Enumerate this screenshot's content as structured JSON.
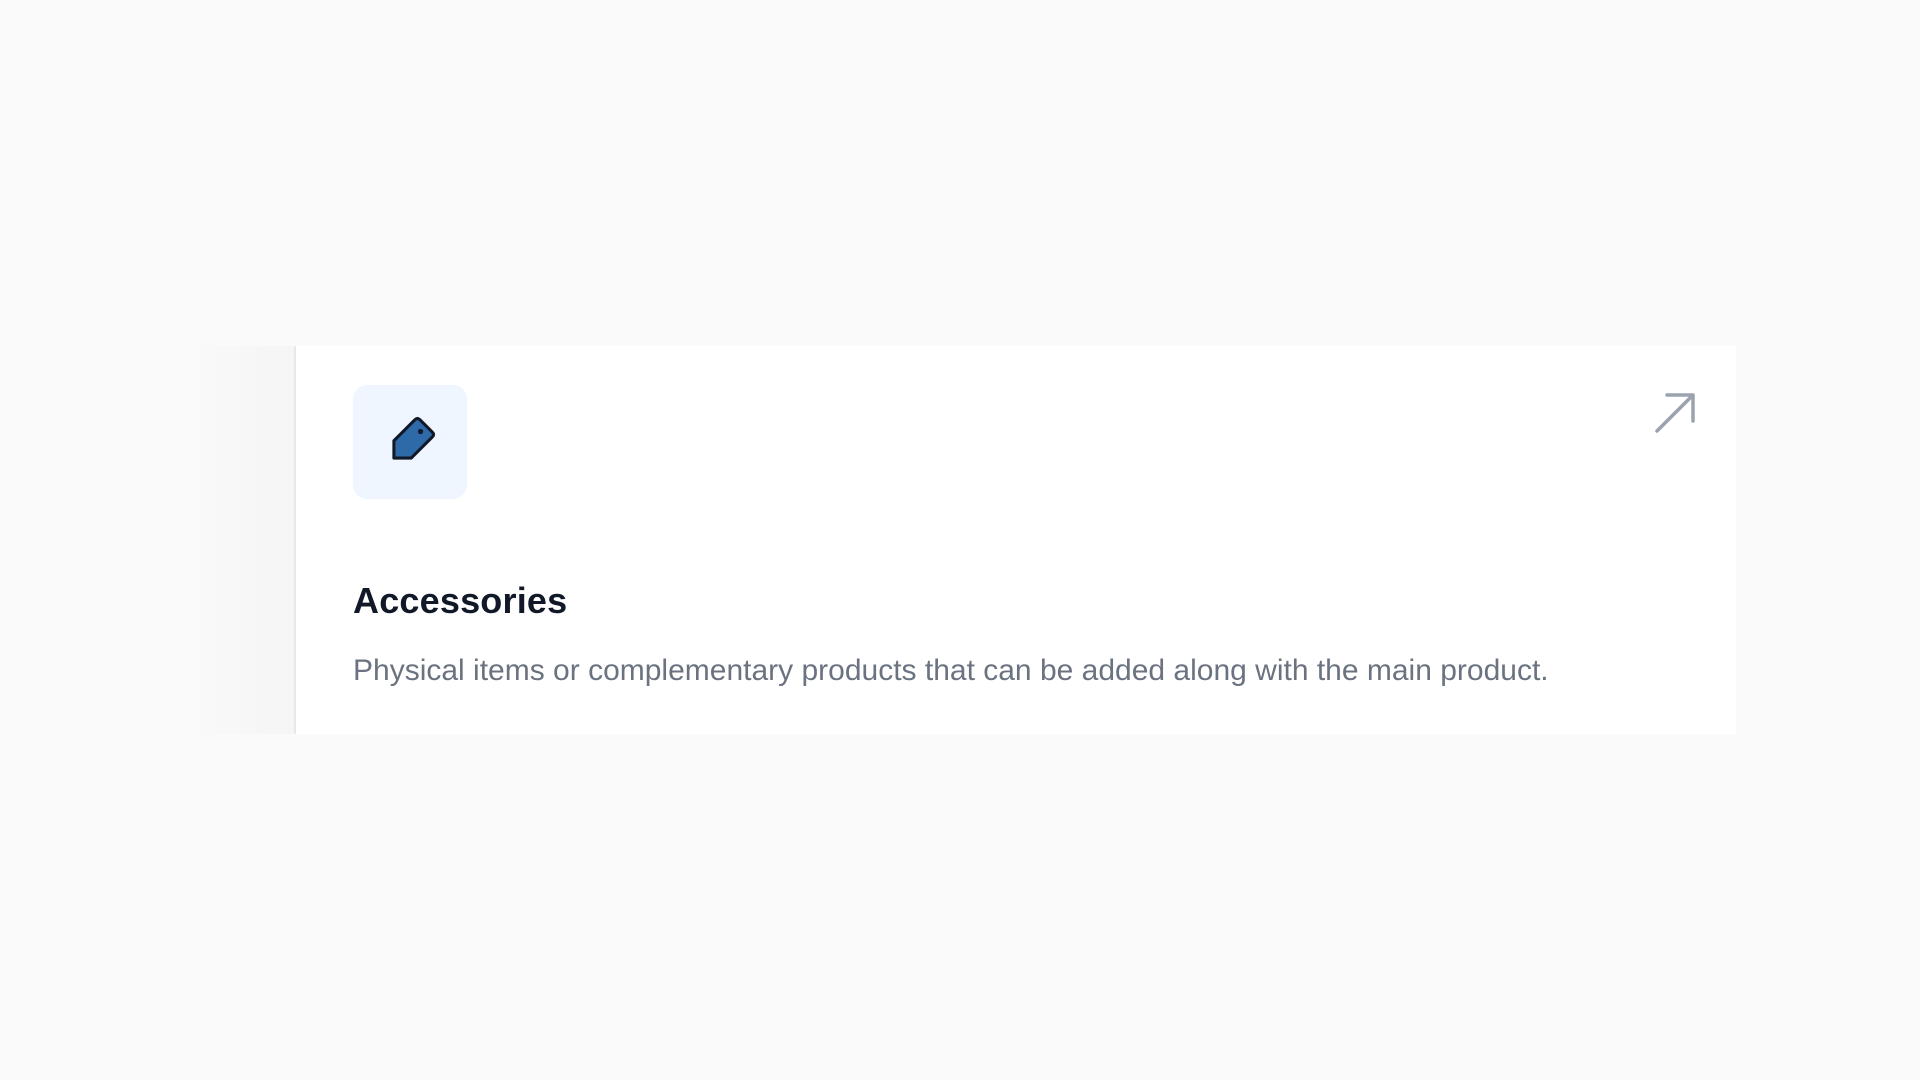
{
  "card": {
    "title": "Accessories",
    "description": "Physical items or complementary products that can be added along with the main product.",
    "icon": "tag-icon",
    "action_icon": "arrow-up-right-icon"
  },
  "colors": {
    "page_background": "#fafafa",
    "card_background": "#ffffff",
    "icon_tile_background": "#eff6ff",
    "icon_fill": "#2f6aa8",
    "title": "#111827",
    "description": "#6b7280",
    "action_icon": "#9ca3af"
  }
}
